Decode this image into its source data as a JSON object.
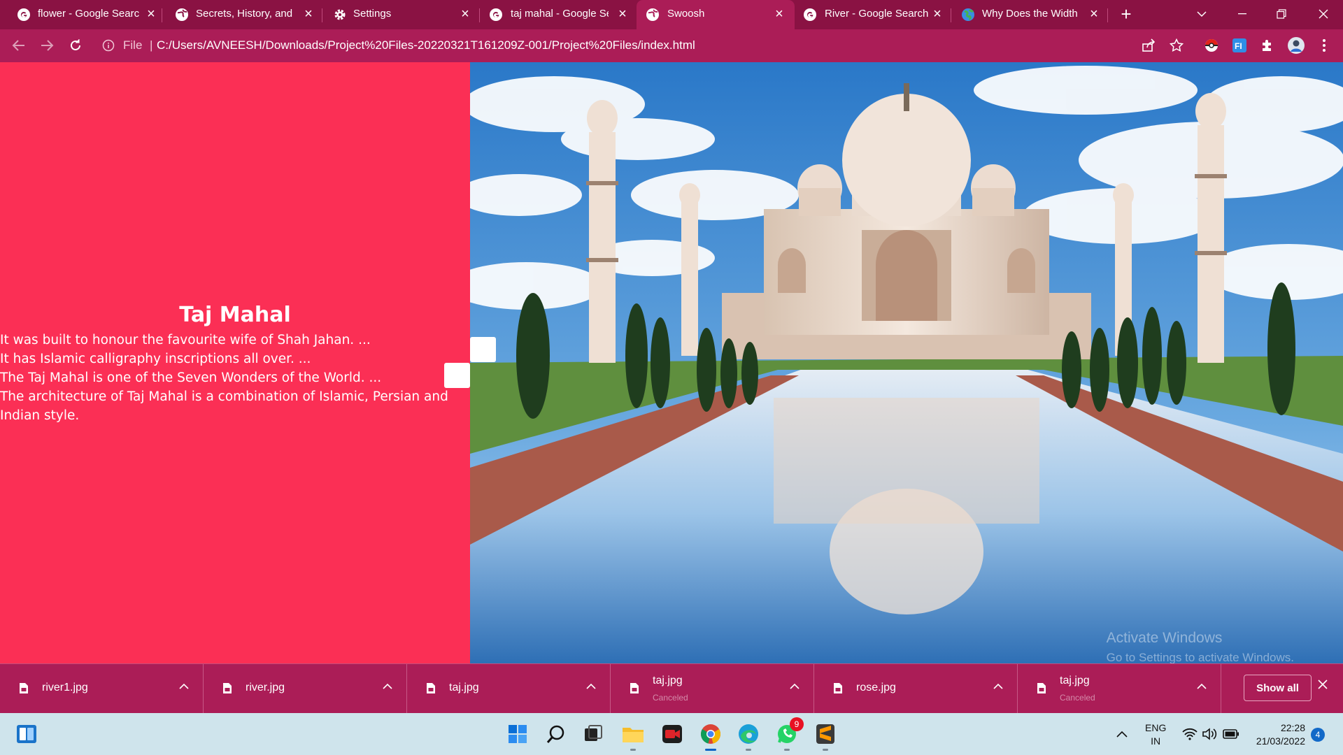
{
  "browser": {
    "tabs": [
      {
        "title": "flower - Google Search",
        "favicon": "google-icon",
        "active": false
      },
      {
        "title": "Secrets, History, and Facts",
        "favicon": "globe-icon",
        "active": false
      },
      {
        "title": "Settings",
        "favicon": "gear-icon",
        "active": false
      },
      {
        "title": "taj mahal - Google Search",
        "favicon": "google-icon",
        "active": false
      },
      {
        "title": "Swoosh",
        "favicon": "globe-icon",
        "active": true
      },
      {
        "title": "River - Google Search",
        "favicon": "google-icon",
        "active": false
      },
      {
        "title": "Why Does the Width",
        "favicon": "earth-icon",
        "active": false
      }
    ],
    "address_bar": {
      "scheme_label": "File",
      "url": "C:/Users/AVNEESH/Downloads/Project%20Files-20220321T161209Z-001/Project%20Files/index.html"
    },
    "colors": {
      "frame": "#8a1243",
      "toolbar": "#ab1d57",
      "page_background": "#fb2f55"
    }
  },
  "page": {
    "heading": "Taj Mahal",
    "facts": [
      "It was built to honour the favourite wife of Shah Jahan. ...",
      "It has Islamic calligraphy inscriptions all over. ...",
      "The Taj Mahal is one of the Seven Wonders of the World. ...",
      "The architecture of Taj Mahal is a combination of Islamic, Persian and Indian style."
    ],
    "image_subject": "Taj Mahal with reflecting pool",
    "watermark": {
      "line1": "Activate Windows",
      "line2": "Go to Settings to activate Windows."
    }
  },
  "downloads": {
    "items": [
      {
        "name": "river1.jpg",
        "status": ""
      },
      {
        "name": "river.jpg",
        "status": ""
      },
      {
        "name": "taj.jpg",
        "status": ""
      },
      {
        "name": "taj.jpg",
        "status": "Canceled"
      },
      {
        "name": "rose.jpg",
        "status": ""
      },
      {
        "name": "taj.jpg",
        "status": "Canceled"
      }
    ],
    "show_all_label": "Show all"
  },
  "taskbar": {
    "apps": [
      "windows-start-icon",
      "search-icon",
      "task-view-icon",
      "file-explorer-icon",
      "screen-recorder-icon",
      "chrome-icon",
      "edge-icon",
      "whatsapp-icon",
      "sublime-text-icon"
    ],
    "whatsapp_badge": "9",
    "language": "ENG",
    "region": "IN",
    "time": "22:28",
    "date": "21/03/2022",
    "notification_count": "4"
  }
}
